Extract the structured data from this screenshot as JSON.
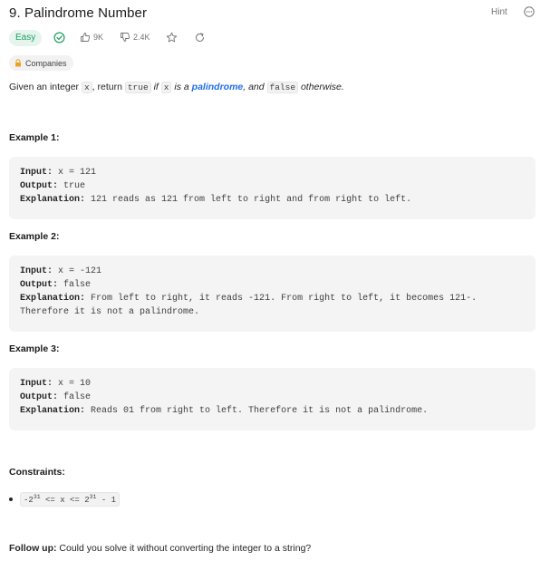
{
  "problem": {
    "title": "9. Palindrome Number",
    "hint_label": "Hint",
    "difficulty": "Easy",
    "likes": "9K",
    "dislikes": "2.4K",
    "companies_label": "Companies"
  },
  "description": {
    "pre": "Given an integer ",
    "x": "x",
    "mid1": ", return ",
    "true_code": "true",
    "mid2": " if ",
    "x2": "x",
    "mid3": " is a ",
    "palindrome_link": "palindrome",
    "mid4": ", and ",
    "false_code": "false",
    "post": " otherwise."
  },
  "examples": [
    {
      "title": "Example 1:",
      "input": "x = 121",
      "output": "true",
      "explanation": "121 reads as 121 from left to right and from right to left."
    },
    {
      "title": "Example 2:",
      "input": "x = -121",
      "output": "false",
      "explanation": "From left to right, it reads -121. From right to left, it becomes 121-.",
      "explanation_line2": "Therefore it is not a palindrome."
    },
    {
      "title": "Example 3:",
      "input": "x = 10",
      "output": "false",
      "explanation": "Reads 01 from right to left. Therefore it is not a palindrome."
    }
  ],
  "labels": {
    "input": "Input:",
    "output": "Output:",
    "explanation": "Explanation:"
  },
  "constraints": {
    "title": "Constraints:",
    "c1_pre": "-2",
    "c1_exp1": "31",
    "c1_mid": " <= x <= 2",
    "c1_exp2": "31",
    "c1_post": " - 1"
  },
  "followup": {
    "label": "Follow up:",
    "text": " Could you solve it without converting the integer to a string?"
  },
  "colors": {
    "easy_text": "#1a9f5f",
    "easy_bg": "#e6f4ee",
    "link": "#1f6feb",
    "lock": "#f0a020"
  }
}
